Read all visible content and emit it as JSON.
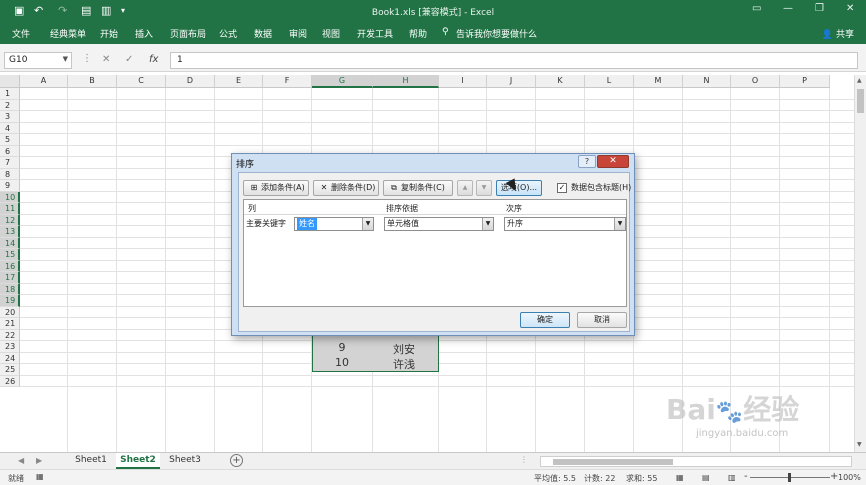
{
  "window": {
    "title": "Book1.xls  [兼容模式]  -  Excel",
    "quick_access": [
      "save-icon",
      "undo-icon",
      "redo-icon",
      "open-icon",
      "print-preview-icon",
      "customize-icon"
    ],
    "controls": [
      "ribbon-display-icon",
      "minimize-icon",
      "restore-icon",
      "close-icon"
    ]
  },
  "ribbon": {
    "tabs": [
      "文件",
      "经典菜单",
      "开始",
      "插入",
      "页面布局",
      "公式",
      "数据",
      "审阅",
      "视图",
      "开发工具",
      "帮助"
    ],
    "tell_me": "告诉我你想要做什么",
    "share": "共享"
  },
  "formula_bar": {
    "name_box": "G10",
    "cancel": "✕",
    "enter": "✓",
    "fx": "fx",
    "value": "1"
  },
  "grid": {
    "columns": [
      "A",
      "B",
      "C",
      "D",
      "E",
      "F",
      "G",
      "H",
      "I",
      "J",
      "K",
      "L",
      "M",
      "N",
      "O",
      "P"
    ],
    "rows": [
      "1",
      "2",
      "3",
      "4",
      "5",
      "6",
      "7",
      "8",
      "9",
      "10",
      "11",
      "12",
      "13",
      "14",
      "15",
      "16",
      "17",
      "18",
      "19",
      "20",
      "21",
      "22",
      "23",
      "24",
      "25",
      "26"
    ],
    "selected_columns": [
      "G",
      "H"
    ],
    "selected_rows": [
      "10",
      "11",
      "12",
      "13",
      "14",
      "15",
      "16",
      "17",
      "18",
      "19"
    ],
    "visible_cells": [
      {
        "g": "9",
        "h": "刘安"
      },
      {
        "g": "10",
        "h": "许浅"
      }
    ]
  },
  "sheets": {
    "tabs": [
      "Sheet1",
      "Sheet2",
      "Sheet3"
    ],
    "active": "Sheet2",
    "add": "+"
  },
  "status": {
    "mode": "就绪",
    "average": "平均值: 5.5",
    "count": "计数: 22",
    "sum": "求和: 55",
    "zoom": "100%",
    "zoom_minus": "-",
    "zoom_plus": "+"
  },
  "dialog": {
    "title": "排序",
    "help": "?",
    "close": "✕",
    "add_level": "添加条件(A)",
    "delete_level": "删除条件(D)",
    "copy_level": "复制条件(C)",
    "move_up": "▲",
    "move_down": "▼",
    "options": "选项(O)...",
    "header_checkbox_label": "数据包含标题(H)",
    "header_checked": true,
    "check_mark": "✓",
    "col_header": "列",
    "sort_on_header": "排序依据",
    "order_header": "次序",
    "row_label": "主要关键字",
    "column_value": "姓名",
    "sort_on_value": "单元格值",
    "order_value": "升序",
    "ok": "确定",
    "cancel": "取消"
  },
  "watermark": {
    "brand": "Bai 经验",
    "url": "jingyan.baidu.com"
  }
}
